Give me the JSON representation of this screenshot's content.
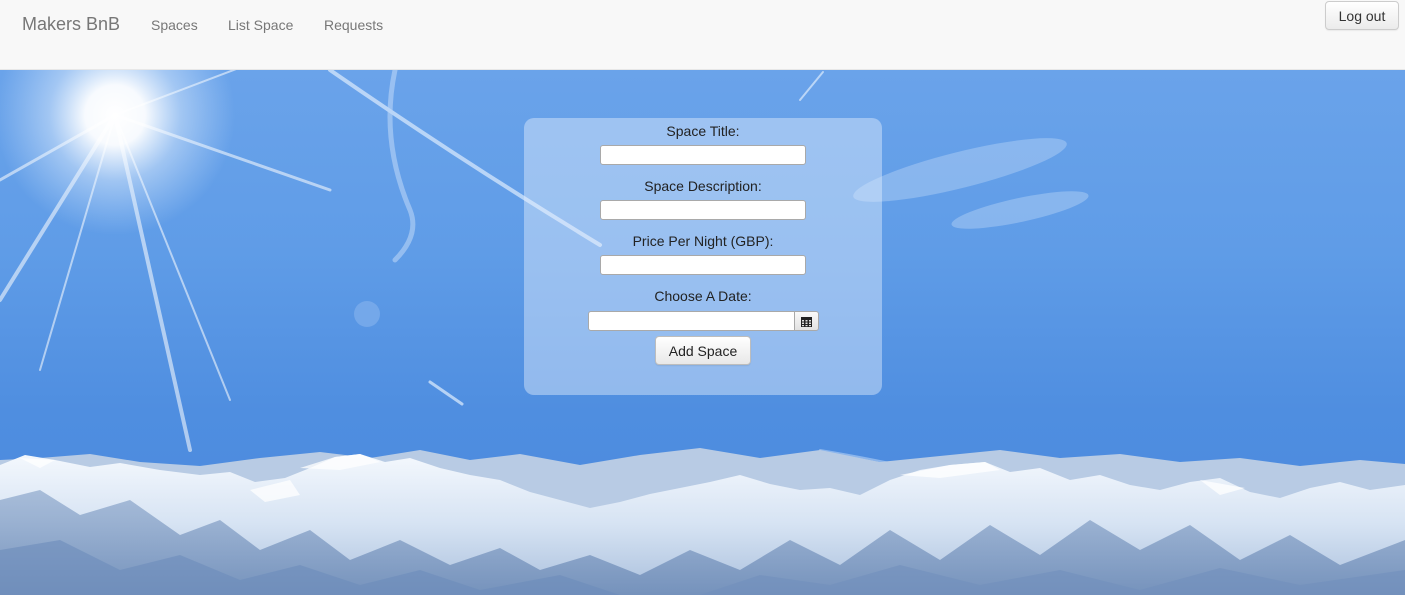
{
  "navbar": {
    "brand": "Makers BnB",
    "links": [
      "Spaces",
      "List Space",
      "Requests"
    ],
    "logout_label": "Log out"
  },
  "form": {
    "fields": [
      {
        "label": "Space Title:",
        "value": ""
      },
      {
        "label": "Space Description:",
        "value": ""
      },
      {
        "label": "Price Per Night (GBP):",
        "value": ""
      },
      {
        "label": "Choose A Date:",
        "value": ""
      }
    ],
    "submit_label": "Add Space"
  },
  "icons": {
    "calendar": "calendar-icon"
  },
  "colors": {
    "navbar_bg": "#f8f8f8",
    "nav_text": "#777777",
    "sky": "#5e9be6"
  }
}
